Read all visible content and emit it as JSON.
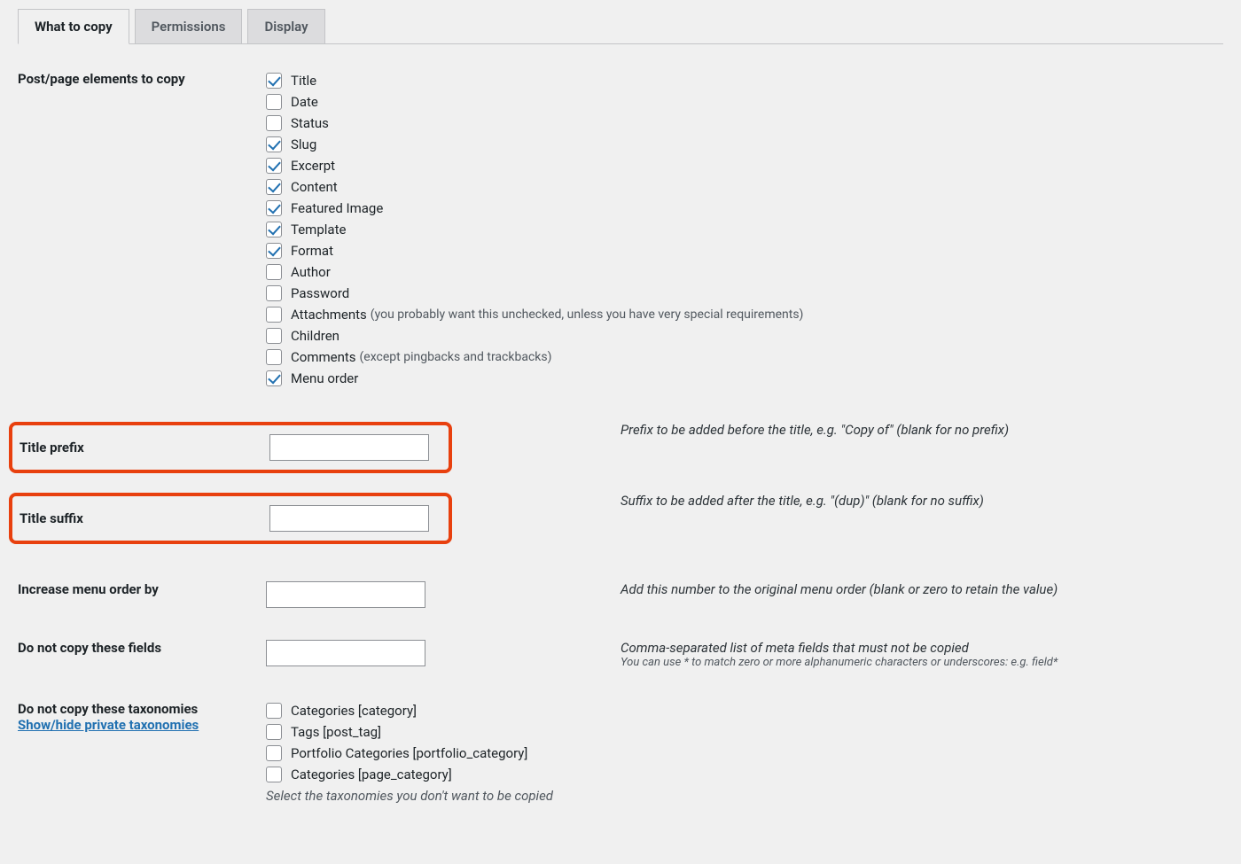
{
  "tabs": [
    {
      "label": "What to copy",
      "active": true
    },
    {
      "label": "Permissions",
      "active": false
    },
    {
      "label": "Display",
      "active": false
    }
  ],
  "elements_label": "Post/page elements to copy",
  "elements": [
    {
      "label": "Title",
      "checked": true
    },
    {
      "label": "Date",
      "checked": false
    },
    {
      "label": "Status",
      "checked": false
    },
    {
      "label": "Slug",
      "checked": true
    },
    {
      "label": "Excerpt",
      "checked": true
    },
    {
      "label": "Content",
      "checked": true
    },
    {
      "label": "Featured Image",
      "checked": true
    },
    {
      "label": "Template",
      "checked": true
    },
    {
      "label": "Format",
      "checked": true
    },
    {
      "label": "Author",
      "checked": false
    },
    {
      "label": "Password",
      "checked": false
    },
    {
      "label": "Attachments",
      "sub": "(you probably want this unchecked, unless you have very special requirements)",
      "checked": false
    },
    {
      "label": "Children",
      "checked": false
    },
    {
      "label": "Comments",
      "sub": "(except pingbacks and trackbacks)",
      "checked": false
    },
    {
      "label": "Menu order",
      "checked": true
    }
  ],
  "title_prefix": {
    "label": "Title prefix",
    "desc": "Prefix to be added before the title, e.g. \"Copy of\" (blank for no prefix)"
  },
  "title_suffix": {
    "label": "Title suffix",
    "desc": "Suffix to be added after the title, e.g. \"(dup)\" (blank for no suffix)"
  },
  "menu_order": {
    "label": "Increase menu order by",
    "desc": "Add this number to the original menu order (blank or zero to retain the value)"
  },
  "blacklist": {
    "label": "Do not copy these fields",
    "desc": "Comma-separated list of meta fields that must not be copied",
    "desc2": "You can use * to match zero or more alphanumeric characters or underscores: e.g. field*"
  },
  "taxonomies": {
    "label": "Do not copy these taxonomies",
    "toggle": "Show/hide private taxonomies",
    "items": [
      {
        "label": "Categories [category]",
        "checked": false
      },
      {
        "label": "Tags [post_tag]",
        "checked": false
      },
      {
        "label": "Portfolio Categories [portfolio_category]",
        "checked": false
      },
      {
        "label": "Categories [page_category]",
        "checked": false
      }
    ],
    "help": "Select the taxonomies you don't want to be copied"
  }
}
